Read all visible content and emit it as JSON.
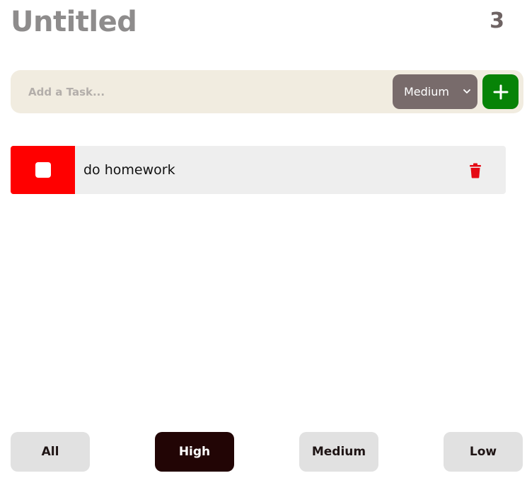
{
  "header": {
    "title": "Untitled",
    "count": "3"
  },
  "add_task": {
    "placeholder": "Add a Task...",
    "priority_selected": "Medium",
    "add_icon": "plus-icon"
  },
  "tasks": [
    {
      "text": "do homework",
      "priority_color": "#ff0000",
      "checkbox_icon": "checkbox-icon",
      "delete_icon": "trash-icon"
    }
  ],
  "filters": [
    {
      "label": "All",
      "active": false
    },
    {
      "label": "High",
      "active": true
    },
    {
      "label": "Medium",
      "active": false
    },
    {
      "label": "Low",
      "active": false
    }
  ],
  "colors": {
    "add_button": "#078307",
    "select_bg": "#786b6b",
    "active_filter": "#220505",
    "high_priority": "#ff0000",
    "delete_icon": "#e50914"
  }
}
